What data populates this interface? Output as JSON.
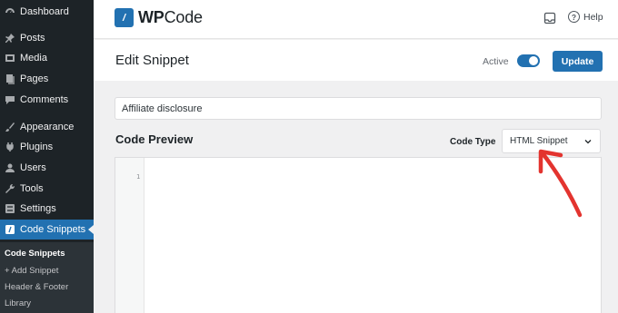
{
  "sidebar": {
    "items": [
      {
        "label": "Dashboard",
        "icon": "dashboard-icon"
      },
      {
        "label": "Posts",
        "icon": "pin-icon"
      },
      {
        "label": "Media",
        "icon": "media-icon"
      },
      {
        "label": "Pages",
        "icon": "pages-icon"
      },
      {
        "label": "Comments",
        "icon": "comments-icon"
      },
      {
        "label": "Appearance",
        "icon": "brush-icon"
      },
      {
        "label": "Plugins",
        "icon": "plug-icon"
      },
      {
        "label": "Users",
        "icon": "user-icon"
      },
      {
        "label": "Tools",
        "icon": "wrench-icon"
      },
      {
        "label": "Settings",
        "icon": "settings-icon"
      },
      {
        "label": "Code Snippets",
        "icon": "code-icon"
      }
    ],
    "submenu": [
      "Code Snippets",
      "+ Add Snippet",
      "Header & Footer",
      "Library"
    ]
  },
  "header": {
    "logo_prefix": "WP",
    "logo_suffix": "Code",
    "help_label": "Help"
  },
  "editbar": {
    "title": "Edit Snippet",
    "active_label": "Active",
    "active": true,
    "update_label": "Update"
  },
  "snippet": {
    "title_value": "Affiliate disclosure"
  },
  "code": {
    "section_title": "Code Preview",
    "type_label": "Code Type",
    "type_value": "HTML Snippet",
    "line_number": "1"
  },
  "colors": {
    "accent": "#2271b1",
    "sidebar_bg": "#1d2327",
    "annotation": "#e3342f"
  }
}
